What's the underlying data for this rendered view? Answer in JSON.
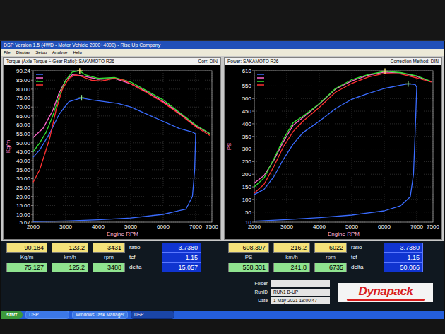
{
  "window": {
    "title": "DSP Version 1.5 (4WD - Motor Vehicle 2000+4000) - Rise Up Company"
  },
  "menu": [
    "File",
    "Display",
    "Setup",
    "Analyse",
    "Help"
  ],
  "charts": [
    {
      "title": "Torque (Axle Torque ÷ Gear Ratio): SAKAMOTO R26",
      "correction": "Corr: DIN",
      "y_label": "Kg/m",
      "x_label": "Engine RPM",
      "y_ticks": [
        "90.24",
        "85.00",
        "80.00",
        "75.00",
        "70.00",
        "65.00",
        "60.00",
        "55.00",
        "50.00",
        "45.00",
        "40.00",
        "35.00",
        "30.00",
        "25.00",
        "20.00",
        "15.00",
        "10.00",
        "5.67"
      ],
      "x_ticks": [
        "2000",
        "3000",
        "4000",
        "5000",
        "6000",
        "7000",
        "7500"
      ],
      "series": [
        {
          "color": "#3a6cff",
          "points": [
            [
              2000,
              42
            ],
            [
              2200,
              46
            ],
            [
              2500,
              55
            ],
            [
              2800,
              66
            ],
            [
              3100,
              73
            ],
            [
              3488,
              75.1
            ],
            [
              3800,
              74
            ],
            [
              4200,
              73
            ],
            [
              4600,
              72
            ],
            [
              5000,
              70
            ],
            [
              5500,
              66
            ],
            [
              6000,
              62
            ],
            [
              6500,
              58
            ],
            [
              6900,
              56
            ],
            [
              7000,
              55
            ],
            [
              6970,
              35
            ],
            [
              6900,
              20
            ],
            [
              6700,
              13
            ],
            [
              6000,
              10
            ],
            [
              5000,
              8
            ],
            [
              4000,
              7
            ],
            [
              3000,
              6.3
            ],
            [
              2000,
              6
            ]
          ]
        },
        {
          "color": "#ff66cc",
          "points": [
            [
              2000,
              53
            ],
            [
              2300,
              58
            ],
            [
              2600,
              68
            ],
            [
              2800,
              78
            ],
            [
              3000,
              85
            ],
            [
              3200,
              88
            ],
            [
              3500,
              87.5
            ],
            [
              4000,
              85.5
            ],
            [
              4500,
              86
            ],
            [
              5000,
              83
            ],
            [
              5500,
              78.5
            ],
            [
              6000,
              73
            ],
            [
              6500,
              66.5
            ],
            [
              7000,
              59.5
            ],
            [
              7450,
              55
            ]
          ]
        },
        {
          "color": "#30e030",
          "points": [
            [
              2000,
              45
            ],
            [
              2200,
              50
            ],
            [
              2400,
              56
            ],
            [
              2600,
              65
            ],
            [
              2800,
              76
            ],
            [
              3000,
              85
            ],
            [
              3200,
              89.5
            ],
            [
              3431,
              90.2
            ],
            [
              3600,
              88
            ],
            [
              4000,
              86
            ],
            [
              4500,
              86.5
            ],
            [
              5000,
              84
            ],
            [
              5500,
              79
            ],
            [
              6000,
              74
            ],
            [
              6500,
              67
            ],
            [
              7000,
              60
            ],
            [
              7450,
              55
            ]
          ]
        },
        {
          "color": "#ff3030",
          "points": [
            [
              2000,
              28
            ],
            [
              2200,
              35
            ],
            [
              2500,
              52
            ],
            [
              2700,
              68
            ],
            [
              2900,
              80
            ],
            [
              3100,
              86
            ],
            [
              3300,
              88
            ],
            [
              3500,
              87
            ],
            [
              3800,
              85
            ],
            [
              4100,
              84.5
            ],
            [
              4500,
              86
            ],
            [
              4800,
              85
            ],
            [
              5100,
              82
            ],
            [
              5500,
              78
            ],
            [
              6000,
              72.5
            ],
            [
              6500,
              66
            ],
            [
              7000,
              59
            ],
            [
              7450,
              54
            ]
          ]
        }
      ],
      "readout": {
        "rows": [
          {
            "color": "#f5e27a",
            "values": [
              "90.184",
              "123.2",
              "3431"
            ]
          },
          {
            "color": "#8fe38f",
            "values": [
              "75.127",
              "125.2",
              "3488"
            ]
          }
        ],
        "units": [
          "Kg/m",
          "km/h",
          "rpm"
        ],
        "params": [
          {
            "label": "ratio",
            "value": "3.7380"
          },
          {
            "label": "tcf",
            "value": "1.15"
          },
          {
            "label": "delta",
            "value": "15.057"
          }
        ]
      }
    },
    {
      "title": "Power: SAKAMOTO R26",
      "correction": "Correction Method: DIN",
      "y_label": "PS",
      "x_label": "Engine RPM",
      "y_ticks": [
        "610",
        "550",
        "500",
        "450",
        "400",
        "350",
        "300",
        "250",
        "200",
        "150",
        "100",
        "50",
        "10"
      ],
      "x_ticks": [
        "2000",
        "3000",
        "4000",
        "5000",
        "6000",
        "7000",
        "7500"
      ],
      "series": [
        {
          "color": "#3a6cff",
          "points": [
            [
              2000,
              120
            ],
            [
              2300,
              140
            ],
            [
              2600,
              190
            ],
            [
              2900,
              260
            ],
            [
              3200,
              320
            ],
            [
              3500,
              365
            ],
            [
              4000,
              410
            ],
            [
              4500,
              460
            ],
            [
              5000,
              497
            ],
            [
              5500,
              520
            ],
            [
              6000,
              540
            ],
            [
              6500,
              553
            ],
            [
              6735,
              558.3
            ],
            [
              6950,
              556
            ],
            [
              7000,
              545
            ],
            [
              6960,
              400
            ],
            [
              6900,
              200
            ],
            [
              6800,
              110
            ],
            [
              6500,
              75
            ],
            [
              6000,
              55
            ],
            [
              5000,
              38
            ],
            [
              4000,
              28
            ],
            [
              3000,
              20
            ],
            [
              2000,
              14
            ]
          ]
        },
        {
          "color": "#ff66cc",
          "points": [
            [
              2000,
              165
            ],
            [
              2300,
              195
            ],
            [
              2600,
              255
            ],
            [
              2900,
              330
            ],
            [
              3200,
              395
            ],
            [
              3500,
              425
            ],
            [
              4000,
              478
            ],
            [
              4500,
              538
            ],
            [
              5000,
              570
            ],
            [
              5500,
              592
            ],
            [
              6000,
              605
            ],
            [
              6500,
              602
            ],
            [
              7000,
              588
            ],
            [
              7450,
              566
            ]
          ]
        },
        {
          "color": "#30e030",
          "points": [
            [
              2000,
              150
            ],
            [
              2300,
              185
            ],
            [
              2600,
              260
            ],
            [
              2900,
              340
            ],
            [
              3200,
              405
            ],
            [
              3500,
              430
            ],
            [
              4000,
              480
            ],
            [
              4500,
              540
            ],
            [
              5000,
              575
            ],
            [
              5500,
              595
            ],
            [
              6022,
              608.4
            ],
            [
              6500,
              603
            ],
            [
              7000,
              590
            ],
            [
              7450,
              568
            ]
          ]
        },
        {
          "color": "#ff3030",
          "points": [
            [
              2000,
              125
            ],
            [
              2300,
              160
            ],
            [
              2600,
              230
            ],
            [
              2900,
              310
            ],
            [
              3200,
              370
            ],
            [
              3500,
              410
            ],
            [
              4000,
              465
            ],
            [
              4500,
              525
            ],
            [
              5000,
              560
            ],
            [
              5500,
              585
            ],
            [
              6000,
              600
            ],
            [
              6500,
              598
            ],
            [
              7000,
              582
            ],
            [
              7450,
              565
            ]
          ]
        }
      ],
      "readout": {
        "rows": [
          {
            "color": "#f5e27a",
            "values": [
              "608.397",
              "216.2",
              "6022"
            ]
          },
          {
            "color": "#8fe38f",
            "values": [
              "558.331",
              "241.8",
              "6735"
            ]
          }
        ],
        "units": [
          "PS",
          "km/h",
          "rpm"
        ],
        "params": [
          {
            "label": "ratio",
            "value": "3.7380"
          },
          {
            "label": "tcf",
            "value": "1.15"
          },
          {
            "label": "delta",
            "value": "50.066"
          }
        ]
      }
    }
  ],
  "fields": [
    {
      "label": "Folder"
    },
    {
      "label": "RunID",
      "value": "RUN1 B-UP"
    },
    {
      "label": "Date",
      "value": "1-May-2021 19:00:47"
    }
  ],
  "logo": "Dynapack",
  "taskbar": {
    "start": "start",
    "items": [
      {
        "label": "DSP",
        "selected": false
      },
      {
        "label": "Windows Task Manager",
        "selected": false
      },
      {
        "label": "DSP",
        "selected": true
      }
    ]
  }
}
